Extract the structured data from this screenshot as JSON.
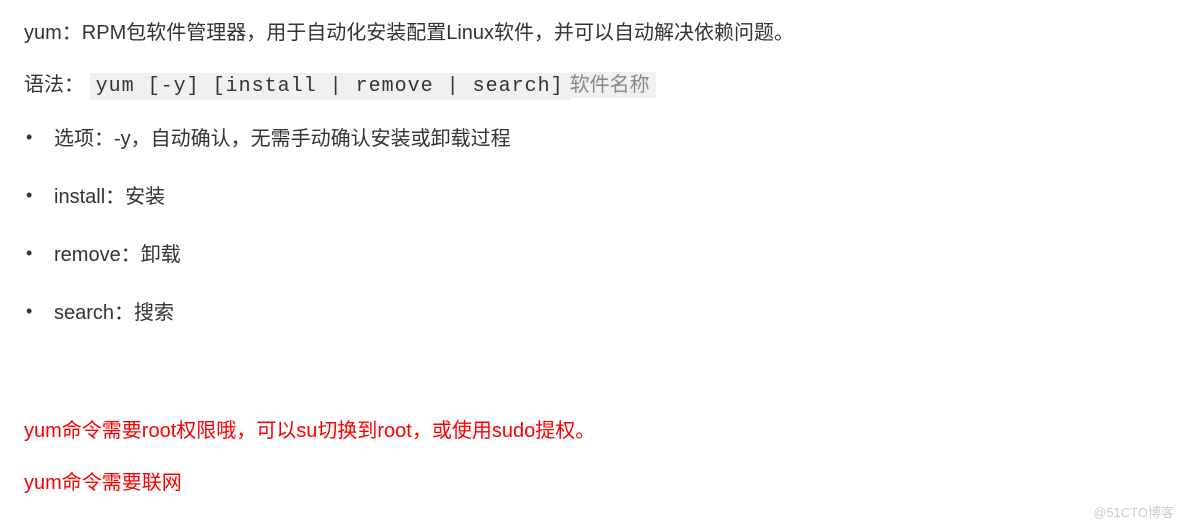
{
  "intro": {
    "text": "yum：RPM包软件管理器，用于自动化安装配置Linux软件，并可以自动解决依赖问题。"
  },
  "syntax": {
    "label": "语法：",
    "code": "yum [-y] [install | remove | search]",
    "argument": "软件名称"
  },
  "options": [
    "选项：-y，自动确认，无需手动确认安装或卸载过程",
    "install：安装",
    "remove：卸载",
    "search：搜索"
  ],
  "notes": {
    "line1": "yum命令需要root权限哦，可以su切换到root，或使用sudo提权。",
    "line2": "yum命令需要联网"
  },
  "watermark": "@51CTO博客"
}
